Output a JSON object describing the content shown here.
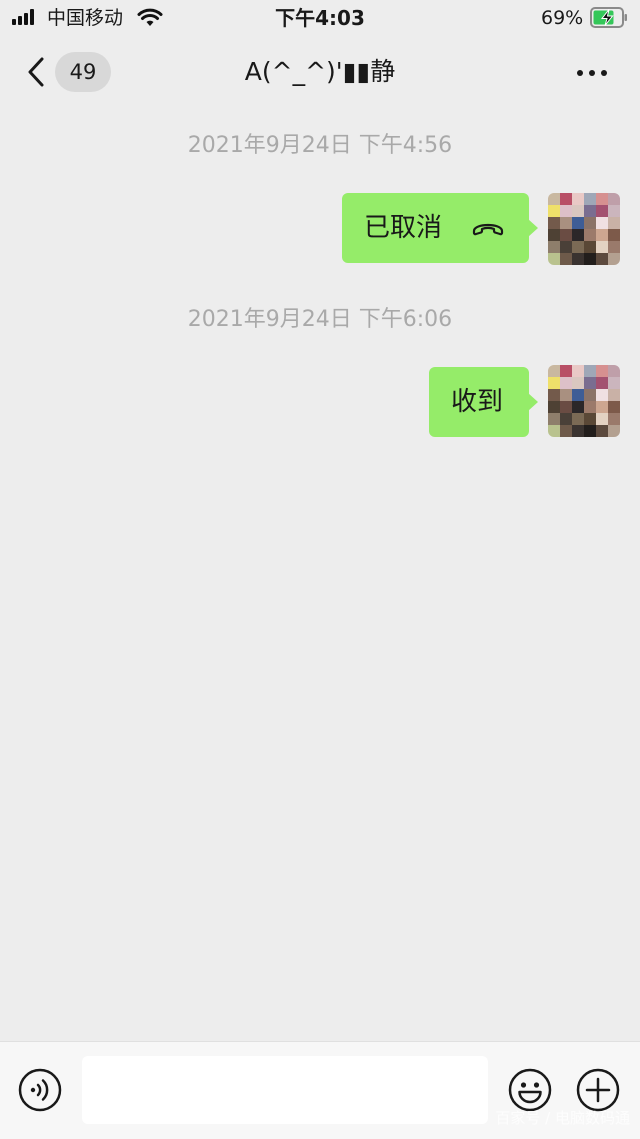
{
  "status_bar": {
    "carrier": "中国移动",
    "time": "下午4:03",
    "battery_percent": "69%",
    "icons": [
      "signal-icon",
      "wifi-icon",
      "battery-charging-icon"
    ]
  },
  "nav": {
    "unread_count": "49",
    "title": "A(^_^)'▮▮静",
    "icons": [
      "back-chevron-icon",
      "more-icon"
    ]
  },
  "messages": [
    {
      "timestamp": "2021年9月24日 下午4:56",
      "text": "已取消",
      "type": "voice-call-cancelled",
      "icon": "hangup-icon",
      "side": "right"
    },
    {
      "timestamp": "2021年9月24日 下午6:06",
      "text": "收到",
      "type": "text",
      "side": "right"
    }
  ],
  "input_bar": {
    "placeholder": "",
    "icons": [
      "voice-icon",
      "emoji-icon",
      "plus-icon"
    ]
  },
  "watermark": "百家号 / 电脑数码通",
  "colors": {
    "background": "#ededed",
    "bubble_self": "#95ec69",
    "timestamp_text": "#a9a9a9",
    "input_bar": "#f7f7f7"
  }
}
